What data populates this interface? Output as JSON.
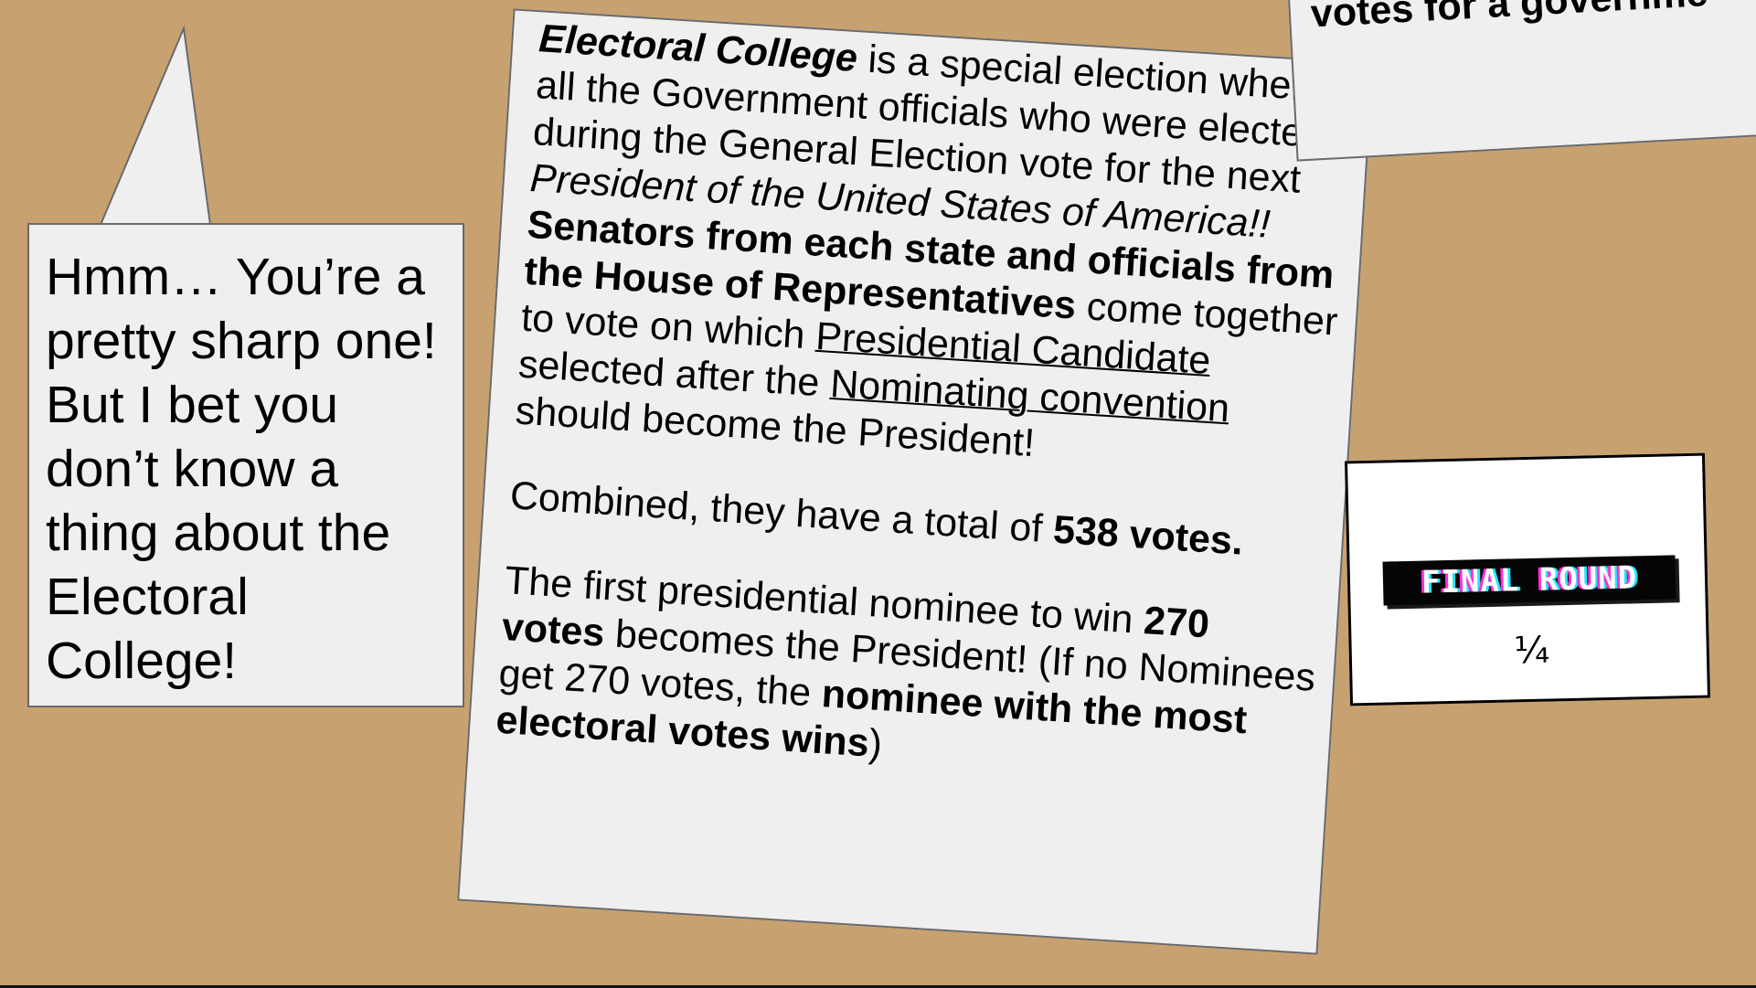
{
  "colors": {
    "background": "#c8a170",
    "card": "#efefef",
    "card_border": "#6a6a6a",
    "text": "#000000",
    "glitch_magenta": "#ff2fd0",
    "glitch_cyan": "#20e8ff"
  },
  "speech_bubble": {
    "lines": [
      "Hmm… You’re a",
      "pretty sharp one!",
      "But I bet you",
      "don’t know a",
      "thing about the",
      "Electoral",
      "College!"
    ]
  },
  "main_card": {
    "p1": {
      "s1": "Electoral College",
      "s2": " is a special election where all the Government officials who were elected during the General Election vote for the next ",
      "s3": "President of the United States of America!!",
      "s4": " ",
      "s5": "Senators from each state and officials from the House of Representatives",
      "s6": " come together to vote on which ",
      "s7": "Presidential Candidate",
      "s8": " selected after the ",
      "s9": "Nominating convention",
      "s10": " should become the President!"
    },
    "p2": {
      "s1": "Combined, they have a total of ",
      "s2": "538 votes."
    },
    "p3": {
      "s1": "The first presidential nominee to win ",
      "s2": "270 votes",
      "s3": " becomes the President! (If no Nominees get 270 votes, the ",
      "s4": "nominee with the most electoral votes wins",
      "s5": ")"
    }
  },
  "corner_card": {
    "text": "votes for a governme"
  },
  "round_card": {
    "label": "FINAL ROUND",
    "fraction": "¼"
  }
}
